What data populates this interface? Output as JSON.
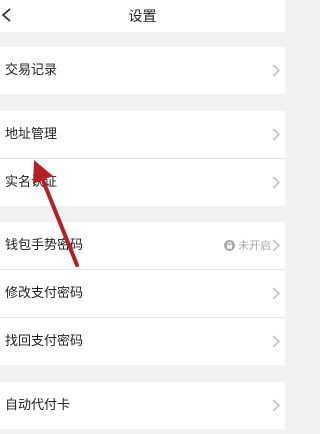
{
  "header": {
    "title": "设置"
  },
  "groups": [
    {
      "items": [
        {
          "label": "交易记录"
        }
      ]
    },
    {
      "items": [
        {
          "label": "地址管理"
        },
        {
          "label": "实名认证"
        }
      ]
    },
    {
      "items": [
        {
          "label": "钱包手势密码",
          "status": "未开启"
        },
        {
          "label": "修改支付密码"
        },
        {
          "label": "找回支付密码"
        }
      ]
    },
    {
      "items": [
        {
          "label": "自动代付卡"
        }
      ]
    }
  ],
  "icons": {
    "back": "chevron-left-icon",
    "row_arrow": "chevron-right-icon",
    "lock": "lock-icon"
  },
  "colors": {
    "annotation_arrow": "#b52027",
    "background": "#f2f2f2"
  }
}
